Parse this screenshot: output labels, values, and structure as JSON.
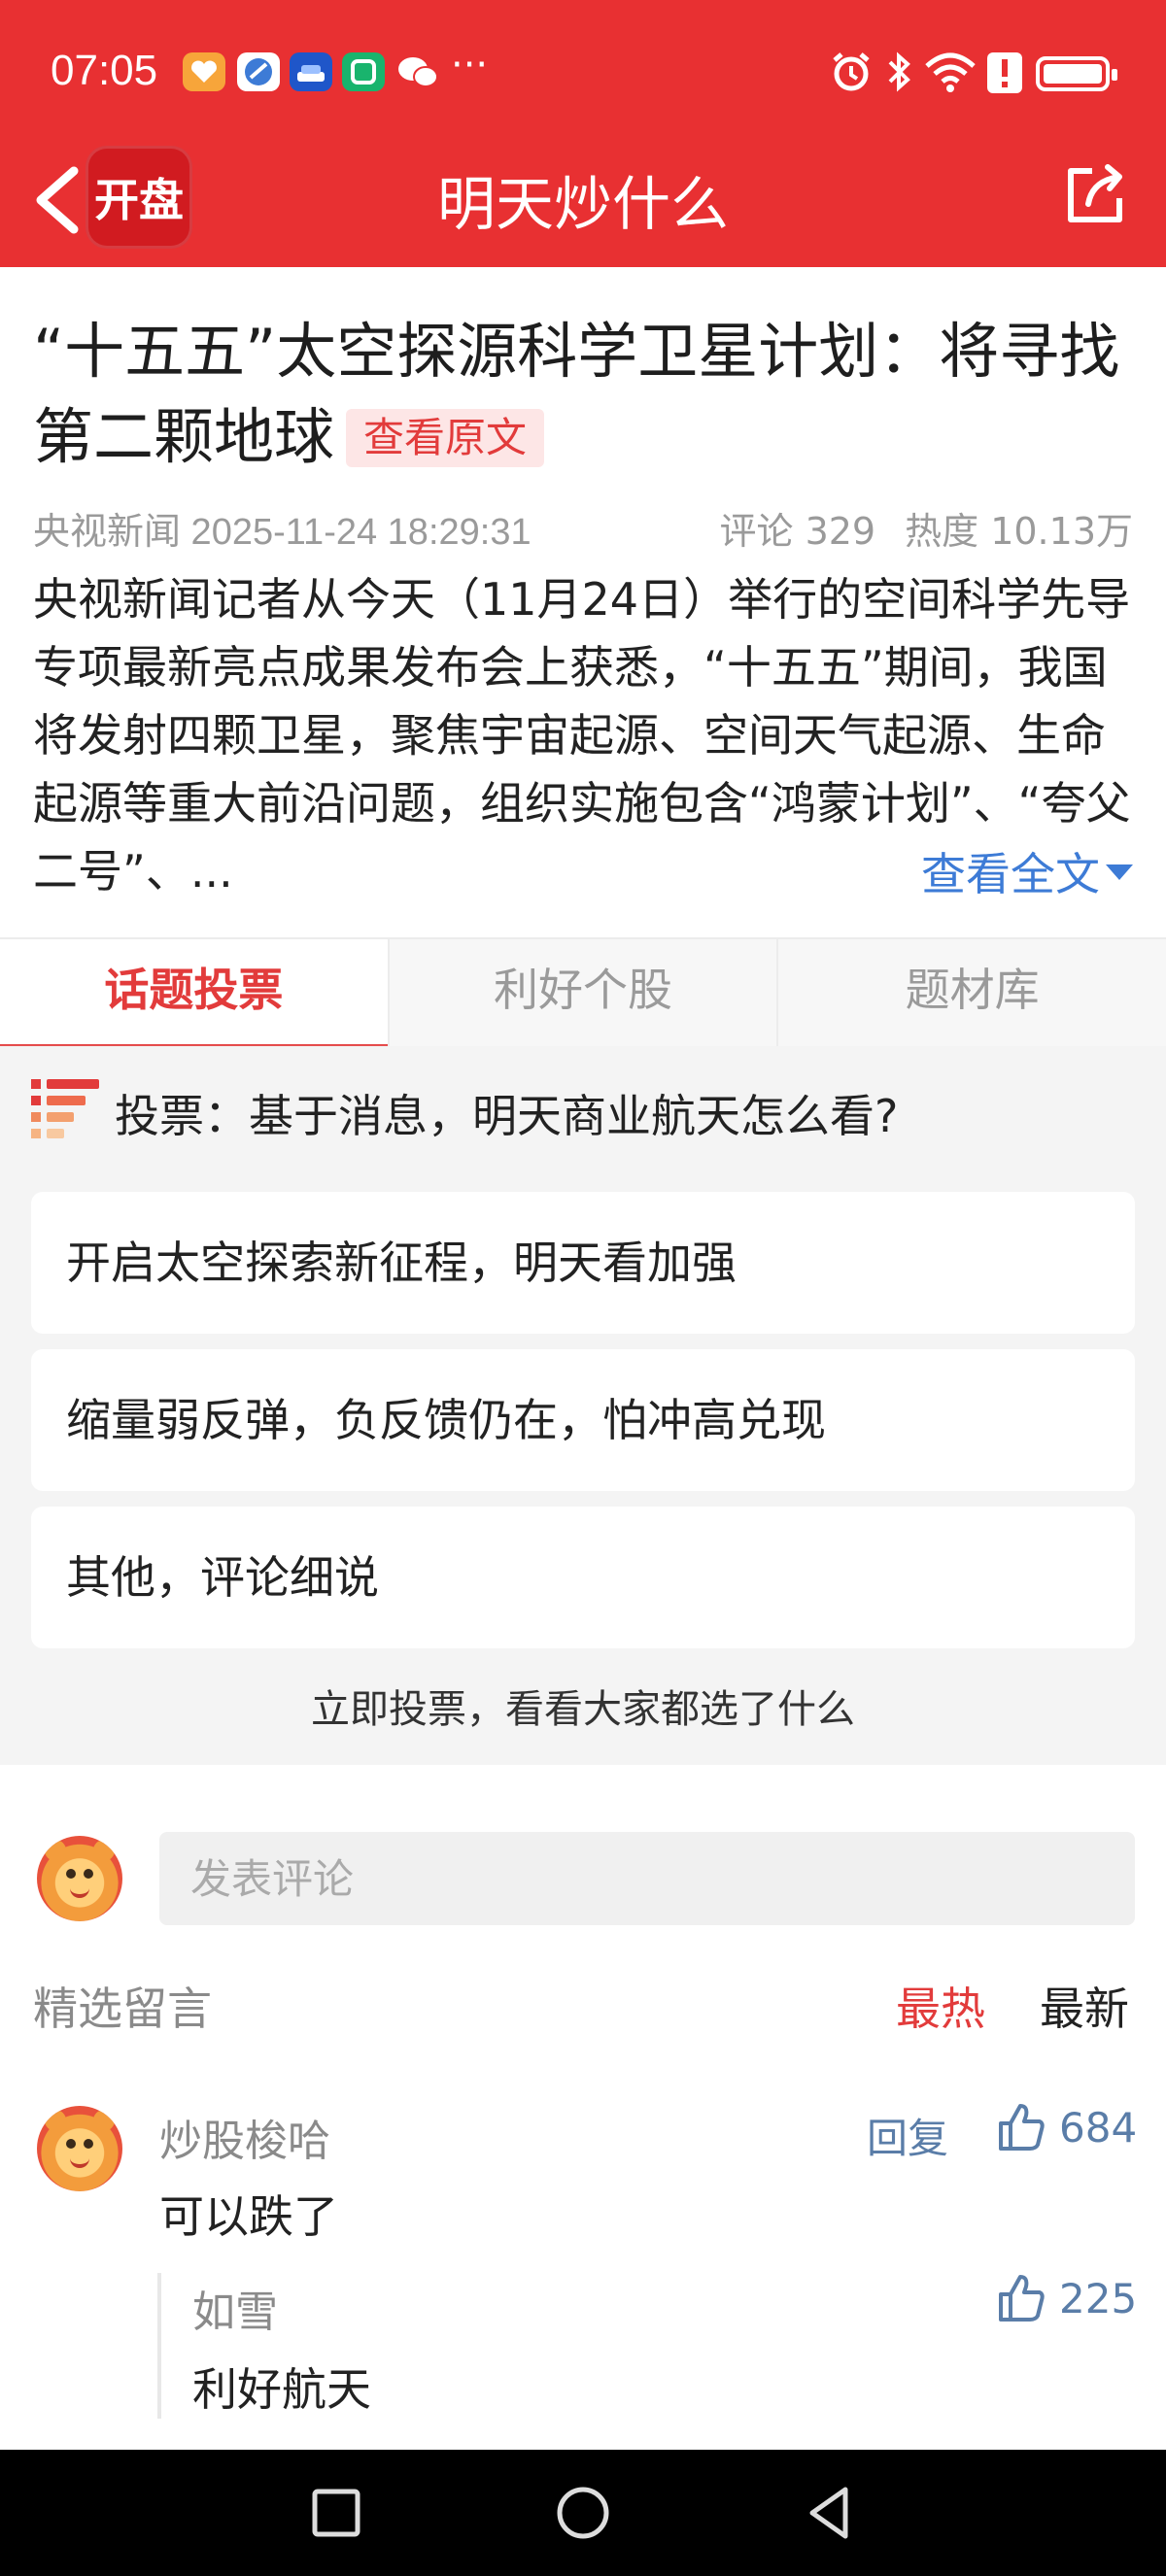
{
  "status_bar": {
    "time": "07:05",
    "icons": [
      "app-icon-orange",
      "app-icon-blue",
      "car-app-icon",
      "app-icon-green",
      "wechat-icon"
    ],
    "more": "···",
    "right_icons": [
      "alarm-icon",
      "bluetooth-icon",
      "wifi-icon",
      "alert-icon",
      "battery-icon"
    ]
  },
  "header": {
    "logo_text": "开盘",
    "title": "明天炒什么"
  },
  "article": {
    "title": "“十五五”太空探源科学卫星计划：将寻找第二颗地球",
    "view_original": "查看原文",
    "source_time": "央视新闻 2025-11-24 18:29:31",
    "comments": "评论 329",
    "heat": "热度 10.13万",
    "body": "央视新闻记者从今天（11月24日）举行的空间科学先导专项最新亮点成果发布会上获悉，“十五五”期间，我国将发射四颗卫星，聚焦宇宙起源、空间天气起源、生命起源等重大前沿问题，组织实施包含“鸿蒙计划”、“夸父二号”、...",
    "read_more": "查看全文"
  },
  "tabs": [
    {
      "label": "话题投票",
      "active": true
    },
    {
      "label": "利好个股",
      "active": false
    },
    {
      "label": "题材库",
      "active": false
    }
  ],
  "vote": {
    "question": "投票：基于消息，明天商业航天怎么看?",
    "options": [
      "开启太空探索新征程，明天看加强",
      "缩量弱反弹，负反馈仍在，怕冲高兑现",
      "其他，评论细说"
    ],
    "cta": "立即投票，看看大家都选了什么"
  },
  "comments_section": {
    "input_placeholder": "发表评论",
    "selected_title": "精选留言",
    "sort_hot": "最热",
    "sort_new": "最新",
    "items": [
      {
        "user": "炒股梭哈",
        "text": "可以跌了",
        "reply_label": "回复",
        "likes": "684",
        "replies": [
          {
            "user": "如雪",
            "text": "利好航天",
            "likes": "225"
          }
        ]
      }
    ]
  },
  "colors": {
    "brand_red": "#e83032",
    "accent_red": "#e23b3b",
    "link_blue": "#3d7bd6"
  }
}
